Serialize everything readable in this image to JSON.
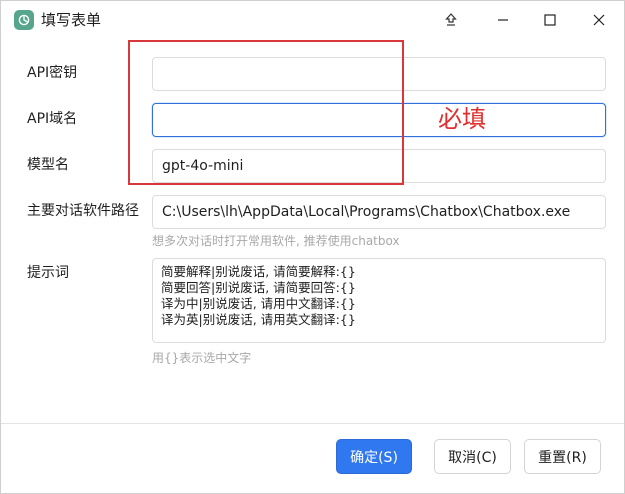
{
  "window": {
    "title": "填写表单",
    "icon": "chatgpt-logo-icon",
    "controls": [
      "pin-icon",
      "minimize-icon",
      "maximize-icon",
      "close-icon"
    ]
  },
  "form": {
    "api_key": {
      "label": "API密钥",
      "value": ""
    },
    "api_domain": {
      "label": "API域名",
      "value": ""
    },
    "model": {
      "label": "模型名",
      "value": "gpt-4o-mini"
    },
    "software_path": {
      "label": "主要对话软件路径",
      "value": "C:\\Users\\lh\\AppData\\Local\\Programs\\Chatbox\\Chatbox.exe",
      "hint": "想多次对话时打开常用软件, 推荐使用chatbox"
    },
    "prompt": {
      "label": "提示词",
      "lines": [
        "简要解释|别说废话, 请简要解释:{}",
        "简要回答|别说废话, 请简要回答:{}",
        "译为中|别说废话, 请用中文翻译:{}",
        "译为英|别说废话, 请用英文翻译:{}"
      ],
      "hint": "用{}表示选中文字"
    }
  },
  "annotation": {
    "text": "必填",
    "color": "#e02d2d"
  },
  "buttons": {
    "ok": "确定(S)",
    "cancel": "取消(C)",
    "reset": "重置(R)"
  },
  "colors": {
    "accent": "#2f78f0",
    "app_icon": "#58a58d"
  }
}
